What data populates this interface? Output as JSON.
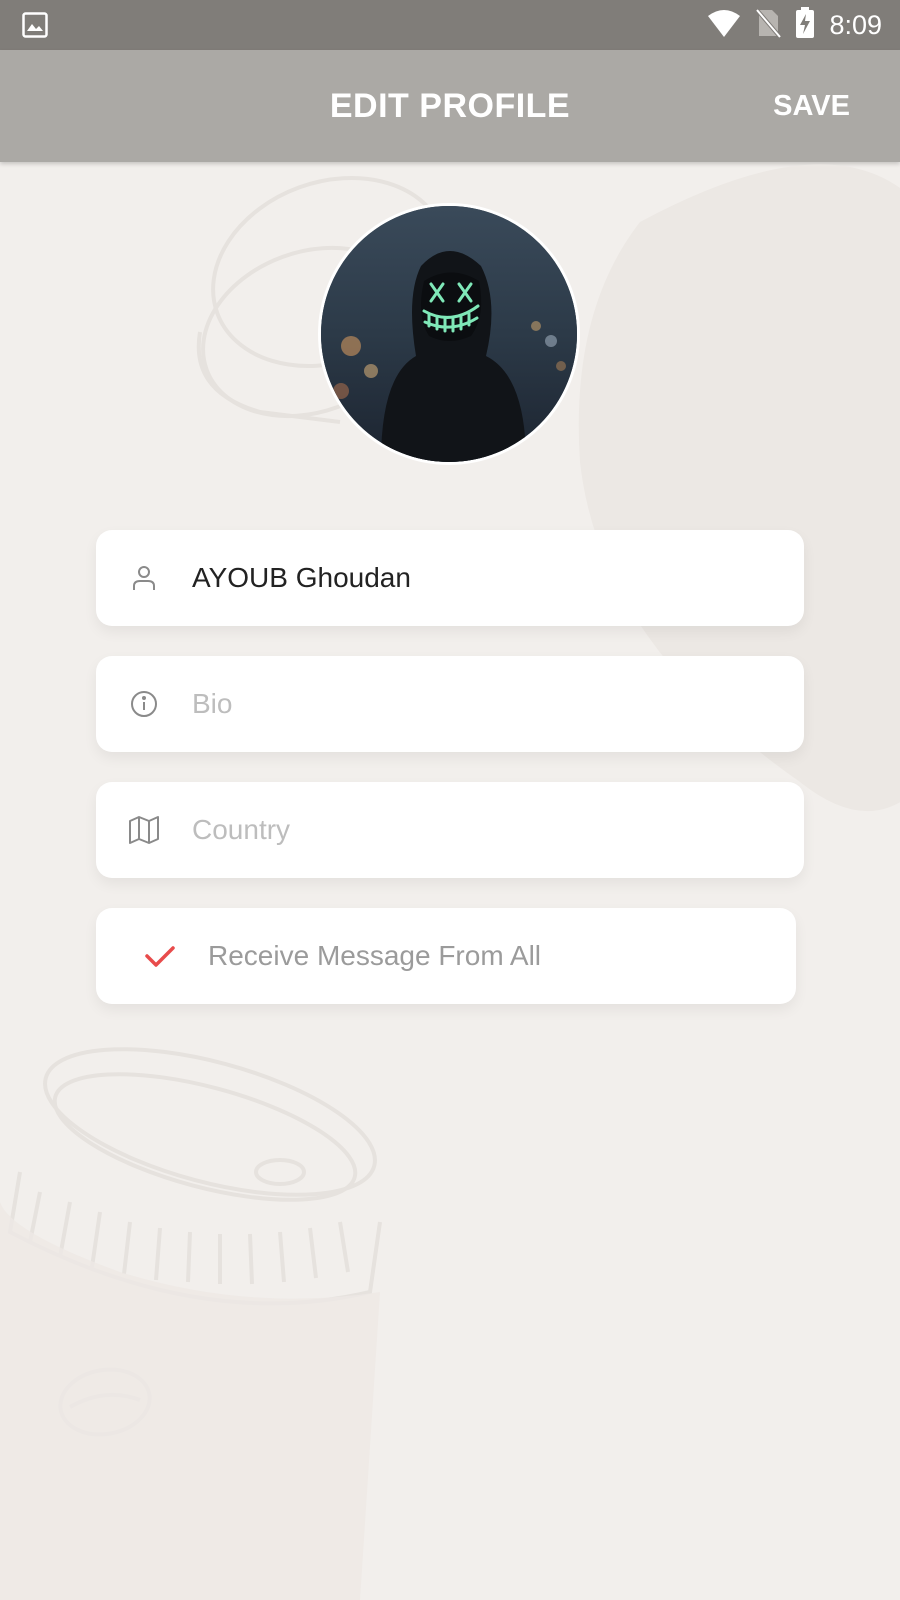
{
  "status_bar": {
    "time": "8:09",
    "left_icon": "image-icon",
    "icons": [
      "wifi-icon",
      "no-sim-icon",
      "battery-charging-icon"
    ]
  },
  "header": {
    "title": "EDIT PROFILE",
    "save_label": "SAVE"
  },
  "profile": {
    "name": "AYOUB Ghoudan",
    "bio_placeholder": "Bio",
    "country_placeholder": "Country",
    "receive_messages_label": "Receive Message From All",
    "receive_messages_checked": true
  },
  "colors": {
    "status_bar": "#807d79",
    "app_bar": "#aba9a5",
    "background": "#f2efec",
    "check_accent": "#e84b4b"
  }
}
